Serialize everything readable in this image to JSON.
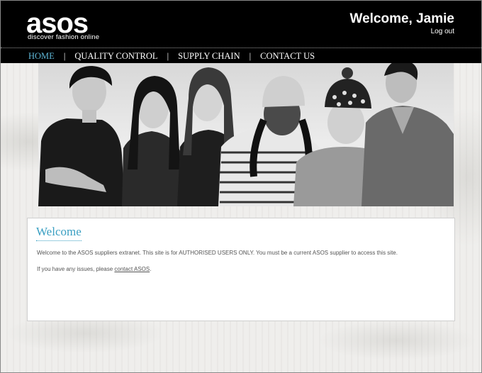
{
  "header": {
    "logo_text": "asos",
    "logo_tagline": "discover fashion online",
    "welcome": "Welcome, Jamie",
    "logout": "Log out"
  },
  "nav": {
    "items": [
      {
        "label": "HOME",
        "active": true
      },
      {
        "label": "QUALITY CONTROL",
        "active": false
      },
      {
        "label": "SUPPLY CHAIN",
        "active": false
      },
      {
        "label": "CONTACT US",
        "active": false
      }
    ],
    "separator": "|"
  },
  "hero": {
    "people_count": 6
  },
  "welcome_panel": {
    "title": "Welcome",
    "paragraph1": "Welcome to the ASOS suppliers extranet. This site is for AUTHORISED USERS ONLY. You must be a current ASOS supplier to access this site.",
    "paragraph2_prefix": "If you have any issues, please ",
    "paragraph2_link": "contact ASOS",
    "paragraph2_suffix": "."
  },
  "colors": {
    "header_bg": "#000000",
    "accent_blue": "#3a9fc2",
    "nav_active": "#5fb8d8",
    "text_body": "#555555"
  }
}
